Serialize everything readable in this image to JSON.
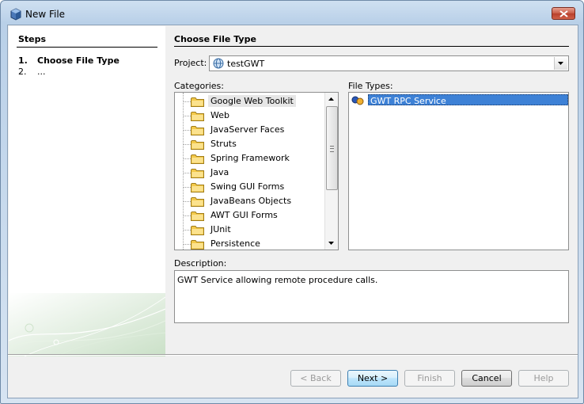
{
  "window": {
    "title": "New File",
    "icon": "cube-icon",
    "close_icon": "close-icon"
  },
  "steps": {
    "heading": "Steps",
    "items": [
      {
        "num": "1.",
        "label": "Choose File Type",
        "current": true
      },
      {
        "num": "2.",
        "label": "...",
        "current": false
      }
    ]
  },
  "main": {
    "heading": "Choose File Type",
    "project_label": "Project:",
    "project_value": "testGWT",
    "categories_label": "Categories:",
    "file_types_label": "File Types:",
    "description_label": "Description:",
    "description_text": "GWT Service allowing remote procedure calls."
  },
  "categories": [
    {
      "label": "Google Web Toolkit",
      "selected": true
    },
    {
      "label": "Web",
      "selected": false
    },
    {
      "label": "JavaServer Faces",
      "selected": false
    },
    {
      "label": "Struts",
      "selected": false
    },
    {
      "label": "Spring Framework",
      "selected": false
    },
    {
      "label": "Java",
      "selected": false
    },
    {
      "label": "Swing GUI Forms",
      "selected": false
    },
    {
      "label": "JavaBeans Objects",
      "selected": false
    },
    {
      "label": "AWT GUI Forms",
      "selected": false
    },
    {
      "label": "JUnit",
      "selected": false
    },
    {
      "label": "Persistence",
      "selected": false
    }
  ],
  "file_types": [
    {
      "label": "GWT RPC Service",
      "selected": true,
      "icon": "gwt-rpc-icon"
    }
  ],
  "buttons": {
    "back": "< Back",
    "next": "Next >",
    "finish": "Finish",
    "cancel": "Cancel",
    "help": "Help"
  },
  "colors": {
    "selection": "#3d81d6",
    "title_bar": "#b9d0e8",
    "folder": "#f3c94a"
  }
}
